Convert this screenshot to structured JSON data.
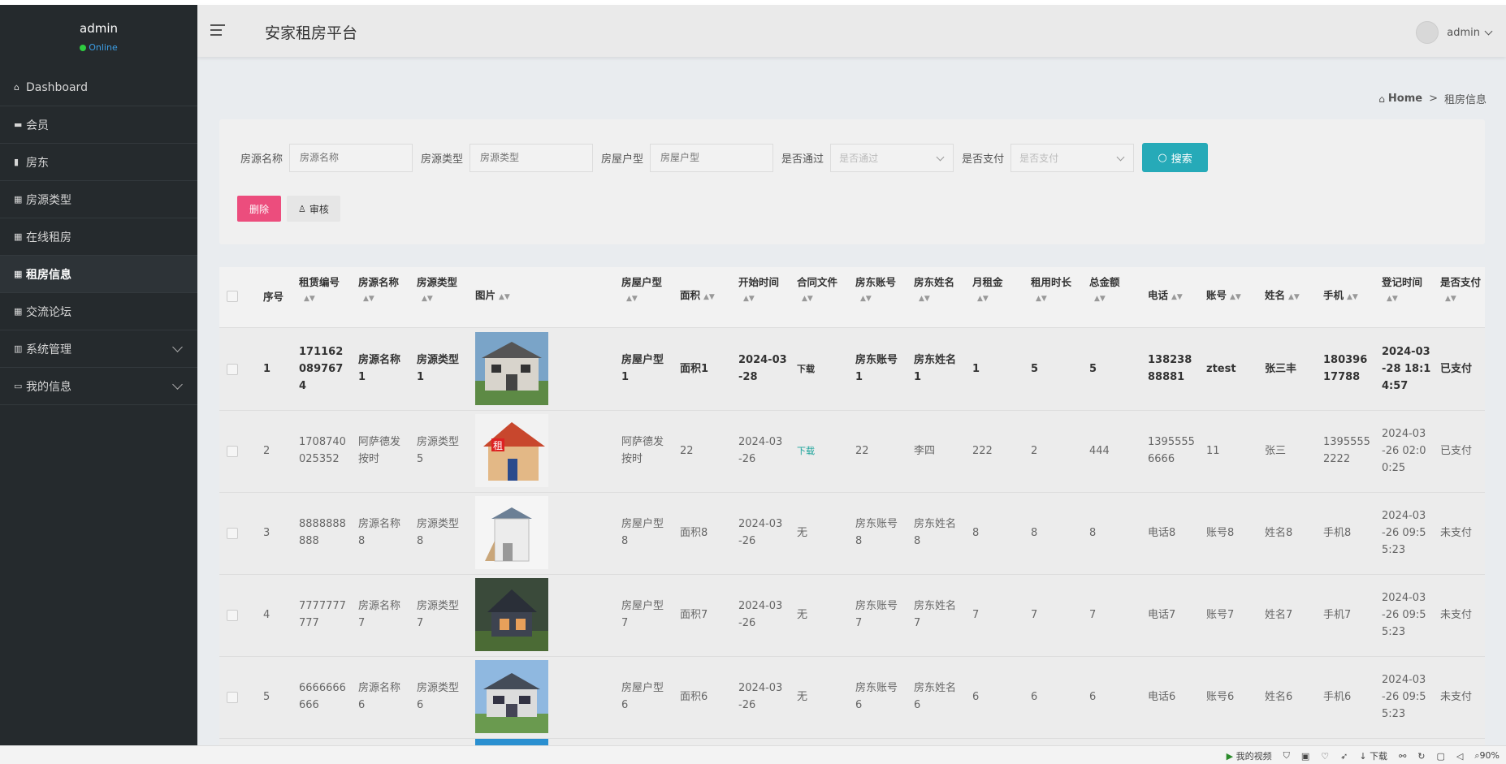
{
  "sidebar": {
    "user": "admin",
    "status": "Online",
    "items": [
      {
        "icon": "home-icon",
        "label": "Dashboard"
      },
      {
        "icon": "briefcase-icon",
        "label": "会员"
      },
      {
        "icon": "book-icon",
        "label": "房东"
      },
      {
        "icon": "grid-icon",
        "label": "房源类型"
      },
      {
        "icon": "grid-icon",
        "label": "在线租房"
      },
      {
        "icon": "grid-icon",
        "label": "租房信息"
      },
      {
        "icon": "grid-icon",
        "label": "交流论坛"
      },
      {
        "icon": "chart-icon",
        "label": "系统管理"
      },
      {
        "icon": "card-icon",
        "label": "我的信息"
      }
    ]
  },
  "header": {
    "title": "安家租房平台",
    "user": "admin"
  },
  "breadcrumb": {
    "home": "Home",
    "current": "租房信息"
  },
  "search": {
    "fields": [
      {
        "label": "房源名称",
        "placeholder": "房源名称"
      },
      {
        "label": "房源类型",
        "placeholder": "房源类型"
      },
      {
        "label": "房屋户型",
        "placeholder": "房屋户型"
      },
      {
        "label": "是否通过",
        "placeholder": "是否通过"
      },
      {
        "label": "是否支付",
        "placeholder": "是否支付"
      }
    ],
    "button": "搜索"
  },
  "actions": {
    "delete": "删除",
    "audit": "审核"
  },
  "table": {
    "headers": [
      "序号",
      "租赁编号",
      "房源名称",
      "房源类型",
      "图片",
      "房屋户型",
      "面积",
      "开始时间",
      "合同文件",
      "房东账号",
      "房东姓名",
      "月租金",
      "租用时长",
      "总金额",
      "电话",
      "账号",
      "姓名",
      "手机",
      "登记时间",
      "是否支付"
    ],
    "rows": [
      {
        "no": "1",
        "code": [
          "171162",
          "089767",
          "4"
        ],
        "name": [
          "房源名称",
          "1"
        ],
        "type": [
          "房源类型",
          "1"
        ],
        "huxing": [
          "房屋户型",
          "1"
        ],
        "area": [
          "面积1"
        ],
        "start": [
          "2024-03",
          "-28"
        ],
        "file": "下载",
        "lacc": [
          "房东账号",
          "1"
        ],
        "lname": [
          "房东姓名",
          "1"
        ],
        "rent": "1",
        "dur": "5",
        "total": "5",
        "tel": [
          "138238",
          "88881"
        ],
        "acc": "ztest",
        "uname": "张三丰",
        "phone": [
          "180396",
          "17788"
        ],
        "reg": [
          "2024-03",
          "-28 18:1",
          "4:57"
        ],
        "paid": "已支付"
      },
      {
        "no": "2",
        "code": [
          "1708740",
          "025352"
        ],
        "name": [
          "阿萨德发",
          "按时"
        ],
        "type": [
          "房源类型",
          "5"
        ],
        "huxing": [
          "阿萨德发",
          "按时"
        ],
        "area": [
          "22"
        ],
        "start": [
          "2024-03",
          "-26"
        ],
        "file": "下载",
        "lacc": [
          "22"
        ],
        "lname": [
          "李四"
        ],
        "rent": "222",
        "dur": "2",
        "total": "444",
        "tel": [
          "1395555",
          "6666"
        ],
        "acc": "11",
        "uname": "张三",
        "phone": [
          "1395555",
          "2222"
        ],
        "reg": [
          "2024-03",
          "-26 02:0",
          "0:25"
        ],
        "paid": "已支付"
      },
      {
        "no": "3",
        "code": [
          "8888888",
          "888"
        ],
        "name": [
          "房源名称",
          "8"
        ],
        "type": [
          "房源类型",
          "8"
        ],
        "huxing": [
          "房屋户型",
          "8"
        ],
        "area": [
          "面积8"
        ],
        "start": [
          "2024-03",
          "-26"
        ],
        "file": "无",
        "lacc": [
          "房东账号",
          "8"
        ],
        "lname": [
          "房东姓名",
          "8"
        ],
        "rent": "8",
        "dur": "8",
        "total": "8",
        "tel": [
          "电话8"
        ],
        "acc": "账号8",
        "uname": "姓名8",
        "phone": [
          "手机8"
        ],
        "reg": [
          "2024-03",
          "-26 09:5",
          "5:23"
        ],
        "paid": "未支付"
      },
      {
        "no": "4",
        "code": [
          "7777777",
          "777"
        ],
        "name": [
          "房源名称",
          "7"
        ],
        "type": [
          "房源类型",
          "7"
        ],
        "huxing": [
          "房屋户型",
          "7"
        ],
        "area": [
          "面积7"
        ],
        "start": [
          "2024-03",
          "-26"
        ],
        "file": "无",
        "lacc": [
          "房东账号",
          "7"
        ],
        "lname": [
          "房东姓名",
          "7"
        ],
        "rent": "7",
        "dur": "7",
        "total": "7",
        "tel": [
          "电话7"
        ],
        "acc": "账号7",
        "uname": "姓名7",
        "phone": [
          "手机7"
        ],
        "reg": [
          "2024-03",
          "-26 09:5",
          "5:23"
        ],
        "paid": "未支付"
      },
      {
        "no": "5",
        "code": [
          "6666666",
          "666"
        ],
        "name": [
          "房源名称",
          "6"
        ],
        "type": [
          "房源类型",
          "6"
        ],
        "huxing": [
          "房屋户型",
          "6"
        ],
        "area": [
          "面积6"
        ],
        "start": [
          "2024-03",
          "-26"
        ],
        "file": "无",
        "lacc": [
          "房东账号",
          "6"
        ],
        "lname": [
          "房东姓名",
          "6"
        ],
        "rent": "6",
        "dur": "6",
        "total": "6",
        "tel": [
          "电话6"
        ],
        "acc": "账号6",
        "uname": "姓名6",
        "phone": [
          "手机6"
        ],
        "reg": [
          "2024-03",
          "-26 09:5",
          "5:23"
        ],
        "paid": "未支付"
      }
    ]
  },
  "taskbar": {
    "video": "我的视频",
    "download": "下载",
    "zoom": "90%"
  },
  "colors": {
    "sidebar": "#252a2d",
    "accent": "#26aab8",
    "danger": "#ec4d7d",
    "download": "#1aa39a"
  }
}
